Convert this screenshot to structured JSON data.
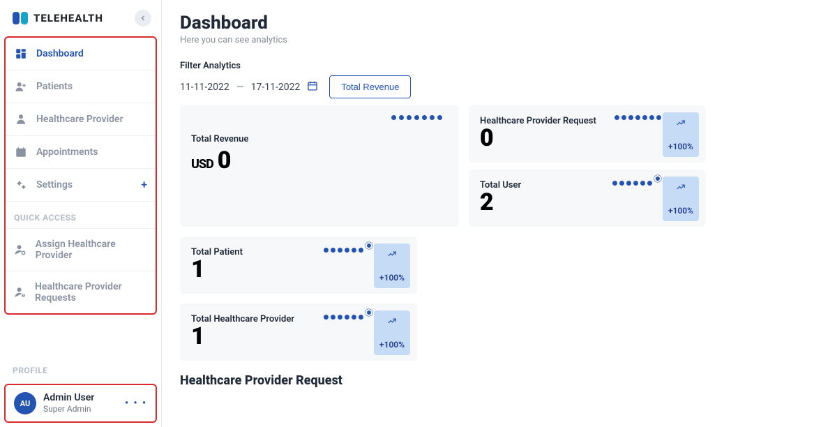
{
  "brand": {
    "name": "TELEHEALTH"
  },
  "sidebar": {
    "items": [
      {
        "label": "Dashboard",
        "icon": "dashboard-icon",
        "active": true
      },
      {
        "label": "Patients",
        "icon": "patients-icon",
        "active": false
      },
      {
        "label": "Healthcare Provider",
        "icon": "provider-icon",
        "active": false
      },
      {
        "label": "Appointments",
        "icon": "calendar-icon",
        "active": false
      },
      {
        "label": "Settings",
        "icon": "gears-icon",
        "active": false,
        "has_plus": true
      }
    ],
    "quick_label": "QUICK ACCESS",
    "quick": [
      {
        "label": "Assign Healthcare Provider",
        "icon": "assign-icon"
      },
      {
        "label": "Healthcare Provider Requests",
        "icon": "requests-icon"
      }
    ],
    "profile_label": "PROFILE",
    "profile": {
      "initials": "AU",
      "name": "Admin User",
      "role": "Super Admin"
    }
  },
  "page": {
    "title": "Dashboard",
    "subtitle": "Here you can see analytics"
  },
  "filter": {
    "label": "Filter Analytics",
    "date_start": "11-11-2022",
    "date_end": "17-11-2022",
    "button": "Total Revenue"
  },
  "cards": {
    "revenue": {
      "title": "Total Revenue",
      "prefix": "USD",
      "value": "0"
    },
    "hcp_req": {
      "title": "Healthcare Provider Request",
      "value": "0",
      "trend": "+100%"
    },
    "user": {
      "title": "Total User",
      "value": "2",
      "trend": "+100%"
    },
    "patient": {
      "title": "Total Patient",
      "value": "1",
      "trend": "+100%"
    },
    "hcp": {
      "title": "Total Healthcare Provider",
      "value": "1",
      "trend": "+100%"
    }
  },
  "section_heading": "Healthcare Provider Request"
}
